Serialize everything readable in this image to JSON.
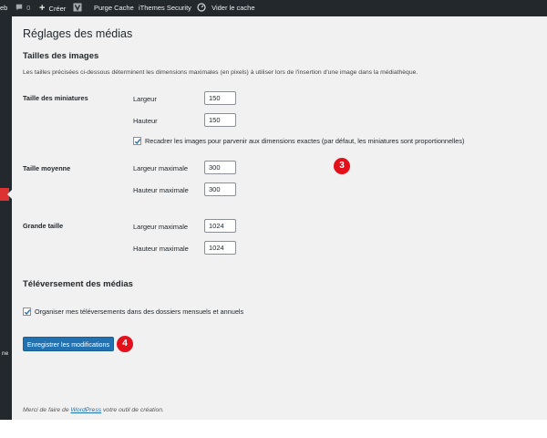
{
  "adminbar": {
    "site_stub": "eb",
    "comments_count": "0",
    "create_label": "Créer",
    "purge_label": "Purge Cache",
    "security_label": "iThemes Security",
    "clear_cache_label": "Vider le cache"
  },
  "sidebar": {
    "stub_label": "ne"
  },
  "page": {
    "title": "Réglages des médias"
  },
  "image_sizes": {
    "heading": "Tailles des images",
    "description": "Les tailles précisées ci-dessous déterminent les dimensions maximales (en pixels) à utiliser lors de l'insertion d'une image dans la médiathèque.",
    "thumbnail": {
      "label": "Taille des miniatures",
      "width_label": "Largeur",
      "width_value": "150",
      "height_label": "Hauteur",
      "height_value": "150",
      "crop_label": "Recadrer les images pour parvenir aux dimensions exactes (par défaut, les miniatures sont proportionnelles)",
      "crop_checked": true
    },
    "medium": {
      "label": "Taille moyenne",
      "width_label": "Largeur maximale",
      "width_value": "300",
      "height_label": "Hauteur maximale",
      "height_value": "300"
    },
    "large": {
      "label": "Grande taille",
      "width_label": "Largeur maximale",
      "width_value": "1024",
      "height_label": "Hauteur maximale",
      "height_value": "1024"
    }
  },
  "uploads": {
    "heading": "Téléversement des médias",
    "organize_label": "Organiser mes téléversements dans des dossiers mensuels et annuels",
    "organize_checked": true
  },
  "save_button": {
    "label": "Enregistrer les modifications"
  },
  "annotations": {
    "badge_1": "3",
    "badge_2": "4"
  },
  "footer": {
    "prefix": "Merci de faire de",
    "link": "WordPress",
    "suffix": "votre outil de création."
  },
  "colors": {
    "adminbar_bg": "#23282d",
    "primary_button": "#2271b1",
    "annotation_badge": "#e3101c",
    "page_bg": "#f1f1f1"
  }
}
